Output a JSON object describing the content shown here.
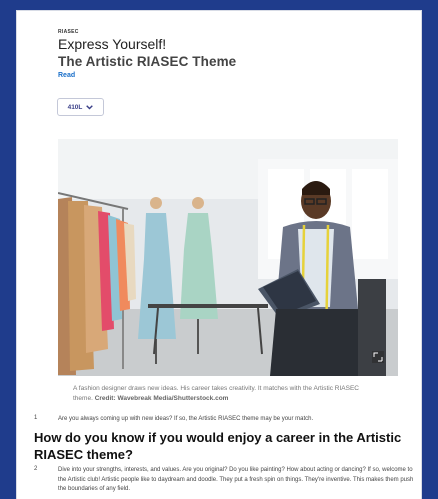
{
  "article": {
    "source": "RIASEC",
    "title": "Express Yourself!",
    "subtitle": "The Artistic RIASEC Theme",
    "read_label": "Read",
    "lexile_label": "410L",
    "caption_text": "A fashion designer draws new ideas. His career takes creativity. It matches with the Artistic RIASEC theme.",
    "caption_credit": "Credit: Wavebreak Media/Shutterstock.com",
    "para1_num": "1",
    "para1": "Are you always coming up with new ideas? If so, the Artistic RIASEC theme may be your match.",
    "heading": "How do you know if you would enjoy a career in the Artistic RIASEC theme?",
    "para2_num": "2",
    "para2": "Dive into your strengths, interests, and values. Are you original? Do you like painting? How about acting or dancing? If so, welcome to the Artistic club! Artistic people like to daydream and doodle. They put a fresh spin on things. They're inventive. This makes them push the boundaries of any field."
  },
  "colors": {
    "frame": "#1f3c8c",
    "link": "#1a6fc9",
    "lexile_text": "#3a3f88"
  },
  "icons": [
    "chevron-down-icon",
    "expand-icon"
  ]
}
